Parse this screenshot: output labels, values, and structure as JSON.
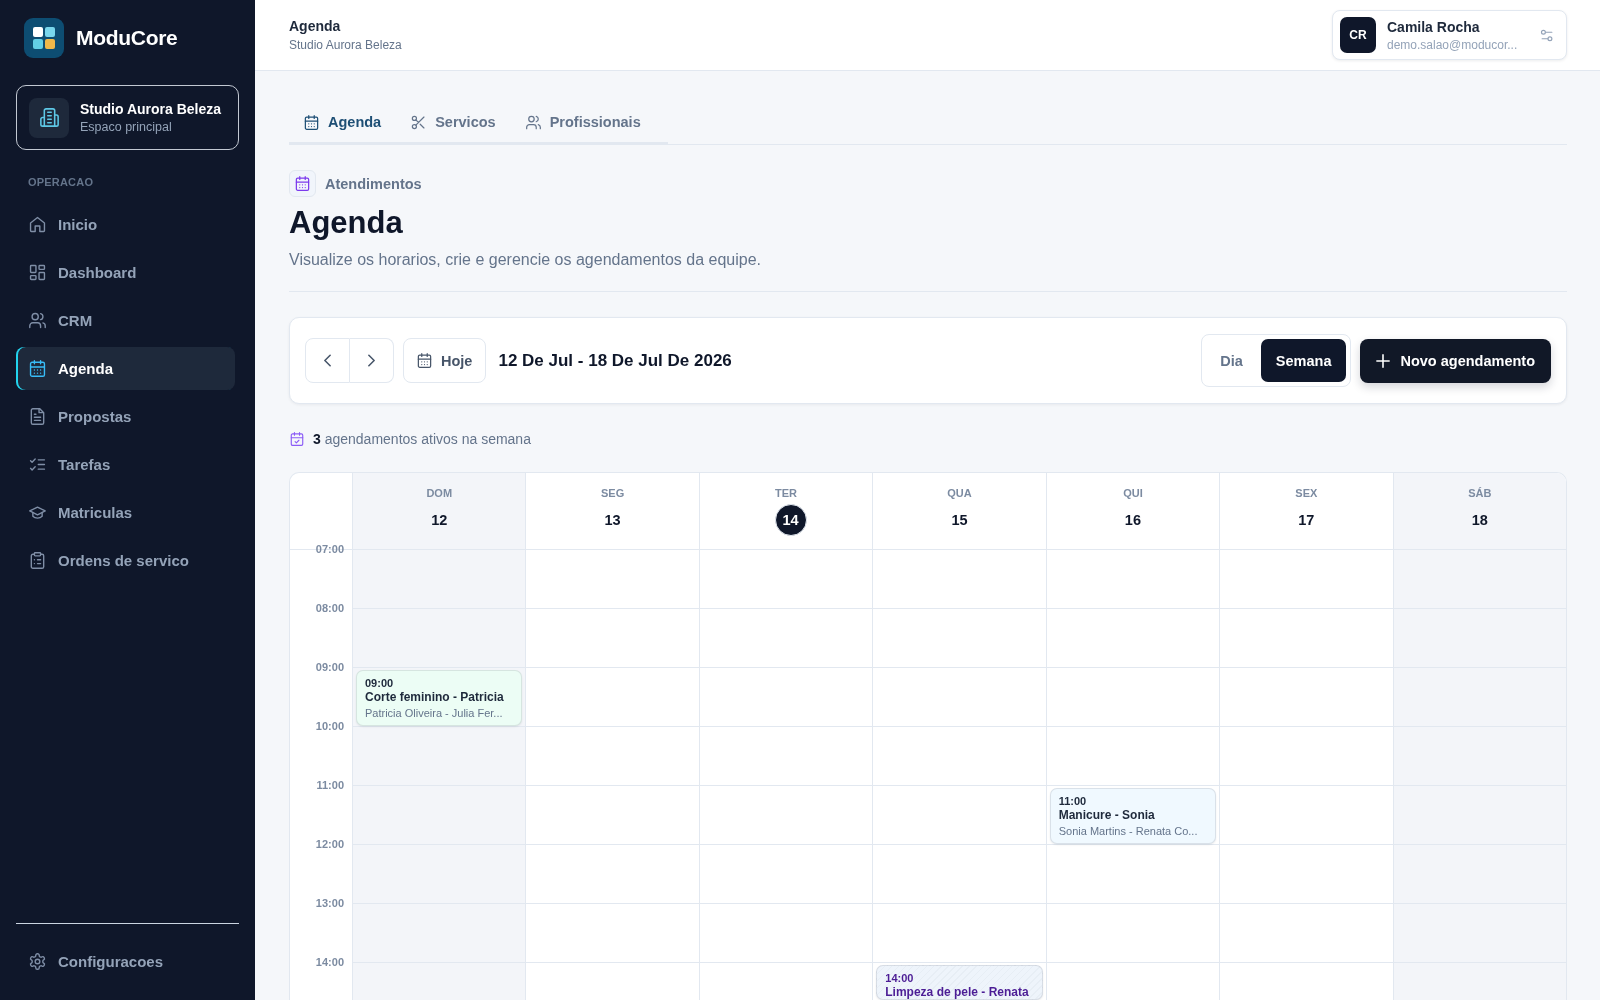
{
  "sidebar": {
    "brand": "ModuCore",
    "workspace": {
      "name": "Studio Aurora Beleza",
      "subtitle": "Espaco principal"
    },
    "section_label": "OPERACAO",
    "items": [
      {
        "label": "Inicio",
        "selected": false
      },
      {
        "label": "Dashboard",
        "selected": false
      },
      {
        "label": "CRM",
        "selected": false
      },
      {
        "label": "Agenda",
        "selected": true
      },
      {
        "label": "Propostas",
        "selected": false
      },
      {
        "label": "Tarefas",
        "selected": false
      },
      {
        "label": "Matriculas",
        "selected": false
      },
      {
        "label": "Ordens de servico",
        "selected": false
      }
    ],
    "footer_items": [
      {
        "label": "Configuracoes",
        "selected": false
      }
    ]
  },
  "top_bar": {
    "title": "Agenda",
    "subtitle": "Studio Aurora Beleza",
    "user": {
      "initials": "CR",
      "name": "Camila Rocha",
      "email": "demo.salao@moducor..."
    }
  },
  "tabs": [
    {
      "label": "Agenda",
      "selected": true
    },
    {
      "label": "Servicos",
      "selected": false
    },
    {
      "label": "Profissionais",
      "selected": false
    }
  ],
  "section_label": "Atendimentos",
  "heading": "Agenda",
  "description": "Visualize os horarios, crie e gerencie os agendamentos da equipe.",
  "toolbar": {
    "today_button": "Hoje",
    "date_range": "12 De Jul - 18 De Jul De 2026",
    "views": [
      {
        "label": "Dia",
        "selected": false
      },
      {
        "label": "Semana",
        "selected": true
      }
    ],
    "new_button": "Novo agendamento"
  },
  "summary": "**3** agendamentos ativos na semana",
  "calendar": {
    "hours": [
      "07:00",
      "08:00",
      "09:00",
      "10:00",
      "11:00",
      "12:00",
      "13:00",
      "14:00"
    ],
    "days": [
      {
        "weekday": "DOM",
        "date": "12",
        "today": false,
        "weekend": true,
        "events": [
          {
            "time": "09:00",
            "title": "Corte feminino - Patricia",
            "people": "Patricia Oliveira - Julia Fer...",
            "color": "#ecfdf5",
            "kind": "plain"
          }
        ]
      },
      {
        "weekday": "SEG",
        "date": "13",
        "today": false,
        "weekend": false
      },
      {
        "weekday": "TER",
        "date": "14",
        "today": true,
        "weekend": false
      },
      {
        "weekday": "QUA",
        "date": "15",
        "today": false,
        "weekend": false,
        "events": [
          {
            "time": "14:00",
            "title": "Limpeza de pele - Renata",
            "color": "#eef4fb",
            "kind": "hatched"
          }
        ]
      },
      {
        "weekday": "QUI",
        "date": "16",
        "today": false,
        "weekend": false,
        "events": [
          {
            "time": "11:00",
            "title": "Manicure - Sonia",
            "people": "Sonia Martins - Renata Co...",
            "color": "#f0f9ff",
            "kind": "plain"
          }
        ]
      },
      {
        "weekday": "SEX",
        "date": "17",
        "today": false,
        "weekend": false
      },
      {
        "weekday": "SÁB",
        "date": "18",
        "today": false,
        "weekend": true
      }
    ]
  }
}
